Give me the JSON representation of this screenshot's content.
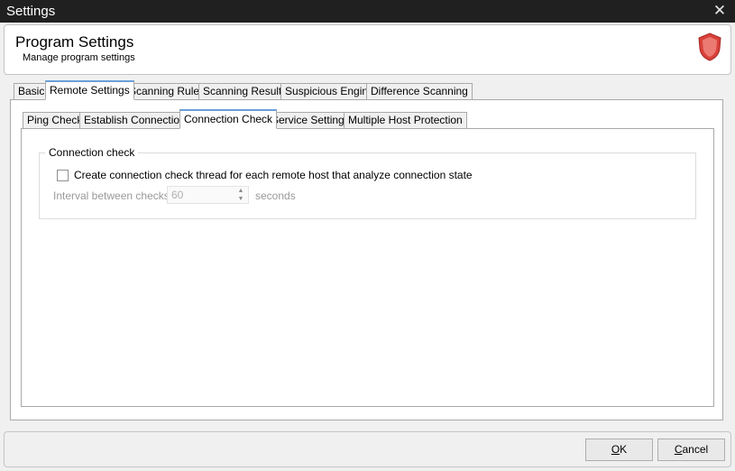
{
  "window": {
    "title": "Settings",
    "close_glyph": "✕"
  },
  "header": {
    "title": "Program Settings",
    "subtitle": "Manage program settings",
    "icon": "shield-icon",
    "icon_color": "#d9413a"
  },
  "main_tabs": [
    {
      "label": "Basic",
      "active": false
    },
    {
      "label": "Remote Settings",
      "active": true
    },
    {
      "label": "Scanning Rules",
      "active": false
    },
    {
      "label": "Scanning Results",
      "active": false
    },
    {
      "label": "Suspicious Engine",
      "active": false
    },
    {
      "label": "Difference Scanning",
      "active": false
    }
  ],
  "sub_tabs": [
    {
      "label": "Ping Check",
      "active": false
    },
    {
      "label": "Establish Connections",
      "active": false
    },
    {
      "label": "Connection Check",
      "active": true
    },
    {
      "label": "Service Settings",
      "active": false
    },
    {
      "label": "Multiple Host Protection",
      "active": false
    }
  ],
  "connection_check": {
    "group_title": "Connection check",
    "checkbox_label": "Create connection check thread for each remote host that analyze connection state",
    "checkbox_checked": false,
    "interval_label": "Interval between checks:",
    "interval_value": "60",
    "interval_unit": "seconds"
  },
  "buttons": {
    "ok_mnemonic": "O",
    "ok_rest": "K",
    "cancel_mnemonic": "C",
    "cancel_rest": "ancel"
  },
  "colors": {
    "titlebar": "#202020",
    "active_tab_accent": "#6a9fd8"
  }
}
